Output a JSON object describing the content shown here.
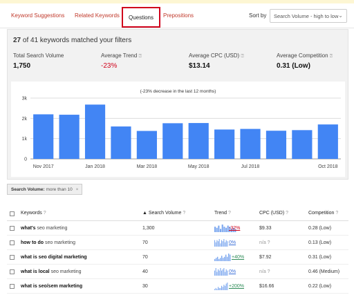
{
  "tabs": [
    {
      "label": "Keyword Suggestions"
    },
    {
      "label": "Related Keywords"
    },
    {
      "label": "Questions"
    },
    {
      "label": "Prepositions"
    }
  ],
  "sort": {
    "label": "Sort by",
    "selected": "Search Volume - high to low"
  },
  "summary": {
    "count": "27",
    "rest": "of 41 keywords matched your filters"
  },
  "metrics": {
    "total_label": "Total Search Volume",
    "total_value": "1,750",
    "trend_label": "Average Trend",
    "trend_value": "-23%",
    "cpc_label": "Average CPC (USD)",
    "cpc_value": "$13.14",
    "comp_label": "Average Competition",
    "comp_value": "0.31 (Low)"
  },
  "chart_data": {
    "type": "bar",
    "title": "(-23% decrease in the last 12 months)",
    "categories": [
      "Nov 2017",
      "Dec 2017",
      "Jan 2018",
      "Feb 2018",
      "Mar 2018",
      "Apr 2018",
      "May 2018",
      "Jun 2018",
      "Jul 2018",
      "Aug 2018",
      "Sep 2018",
      "Oct 2018"
    ],
    "x_tick_labels": [
      "Nov 2017",
      "Jan 2018",
      "Mar 2018",
      "May 2018",
      "Jul 2018",
      "Oct 2018"
    ],
    "x_tick_indices": [
      0,
      2,
      4,
      6,
      8,
      11
    ],
    "values": [
      2200,
      2180,
      2680,
      1600,
      1380,
      1760,
      1770,
      1450,
      1480,
      1390,
      1420,
      1700
    ],
    "y_ticks": [
      "0",
      "1k",
      "2k",
      "3k"
    ],
    "ylim": [
      0,
      3000
    ],
    "color": "#4285f4",
    "grid": true
  },
  "filter_chip": {
    "label": "Search Volume:",
    "value": "more than 10",
    "close": "×"
  },
  "table": {
    "headers": {
      "keywords": "Keywords",
      "volume": "Search Volume",
      "trend": "Trend",
      "cpc": "CPC (USD)",
      "competition": "Competition"
    },
    "sort_arrow": "▲",
    "help_glyph": "?",
    "rows": [
      {
        "kw_head": "what's",
        "kw_tail": "seo marketing",
        "volume": "1,300",
        "trend": "-32%",
        "trend_class": "neg",
        "cpc": "$9.33",
        "comp": "0.28 (Low)",
        "spark": [
          5,
          4,
          6,
          3,
          7,
          5,
          4,
          6,
          5,
          3,
          4,
          3
        ]
      },
      {
        "kw_head": "how to do",
        "kw_tail": "seo marketing",
        "volume": "70",
        "trend": "0%",
        "trend_class": "zero",
        "cpc": "n/a ?",
        "comp": "0.13 (Low)",
        "spark": [
          6,
          4,
          6,
          5,
          7,
          3,
          6,
          5,
          7,
          4,
          6,
          5
        ]
      },
      {
        "kw_head": "what is seo digital marketing",
        "kw_tail": "",
        "volume": "70",
        "trend": "+40%",
        "trend_class": "pos",
        "cpc": "$7.92",
        "comp": "0.31 (Low)",
        "spark": [
          2,
          3,
          4,
          2,
          3,
          5,
          3,
          4,
          6,
          4,
          7,
          6
        ]
      },
      {
        "kw_head": "what is local",
        "kw_tail": "seo marketing",
        "volume": "40",
        "trend": "0%",
        "trend_class": "zero",
        "cpc": "n/a ?",
        "comp": "0.46 (Medium)",
        "spark": [
          4,
          6,
          3,
          5,
          4,
          6,
          4,
          5,
          6,
          3,
          5,
          4
        ]
      },
      {
        "kw_head": "what is seo/sem marketing",
        "kw_tail": "",
        "volume": "30",
        "trend": "+200%",
        "trend_class": "pos",
        "cpc": "$16.66",
        "comp": "0.22 (Low)",
        "spark": [
          1,
          2,
          1,
          3,
          2,
          2,
          4,
          3,
          5,
          4,
          6,
          7
        ]
      }
    ]
  }
}
